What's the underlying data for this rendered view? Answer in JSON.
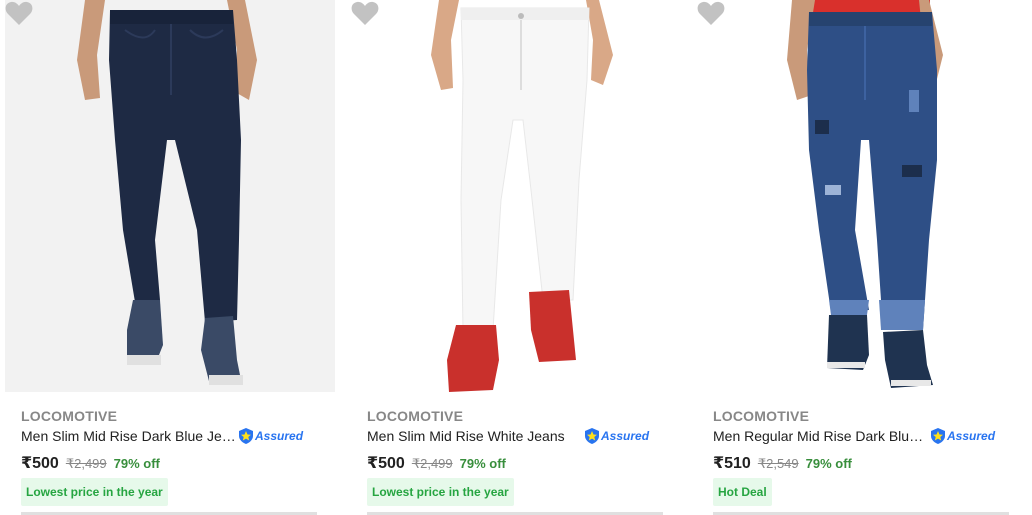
{
  "products": [
    {
      "brand": "LOCOMOTIVE",
      "title": "Men Slim Mid Rise Dark Blue Jeans",
      "assured_label": "Assured",
      "price": "₹500",
      "mrp": "₹2,499",
      "discount": "79% off",
      "tag": "Lowest price in the year",
      "image_bg": "#f2f2f2",
      "jeans_color": "#1e2a44",
      "shoe_color": "#3a4a66",
      "icon": "dark-blue-jeans-image"
    },
    {
      "brand": "LOCOMOTIVE",
      "title": "Men Slim Mid Rise White Jeans",
      "assured_label": "Assured",
      "price": "₹500",
      "mrp": "₹2,499",
      "discount": "79% off",
      "tag": "Lowest price in the year",
      "image_bg": "#ffffff",
      "jeans_color": "#f7f7f7",
      "shoe_color": "#c9302c",
      "icon": "white-jeans-image"
    },
    {
      "brand": "LOCOMOTIVE",
      "title": "Men Regular Mid Rise Dark Blue Jeans",
      "assured_label": "Assured",
      "price": "₹510",
      "mrp": "₹2,549",
      "discount": "79% off",
      "tag": "Hot Deal",
      "image_bg": "#ffffff",
      "jeans_color": "#2e4f86",
      "shoe_color": "#1f3350",
      "icon": "distressed-jeans-image"
    }
  ],
  "colors": {
    "heart": "#c2c2c2",
    "discount": "#388e3c",
    "assured_blue": "#2874f0",
    "tag_bg": "#e6f9ea",
    "tag_text": "#26a541"
  }
}
